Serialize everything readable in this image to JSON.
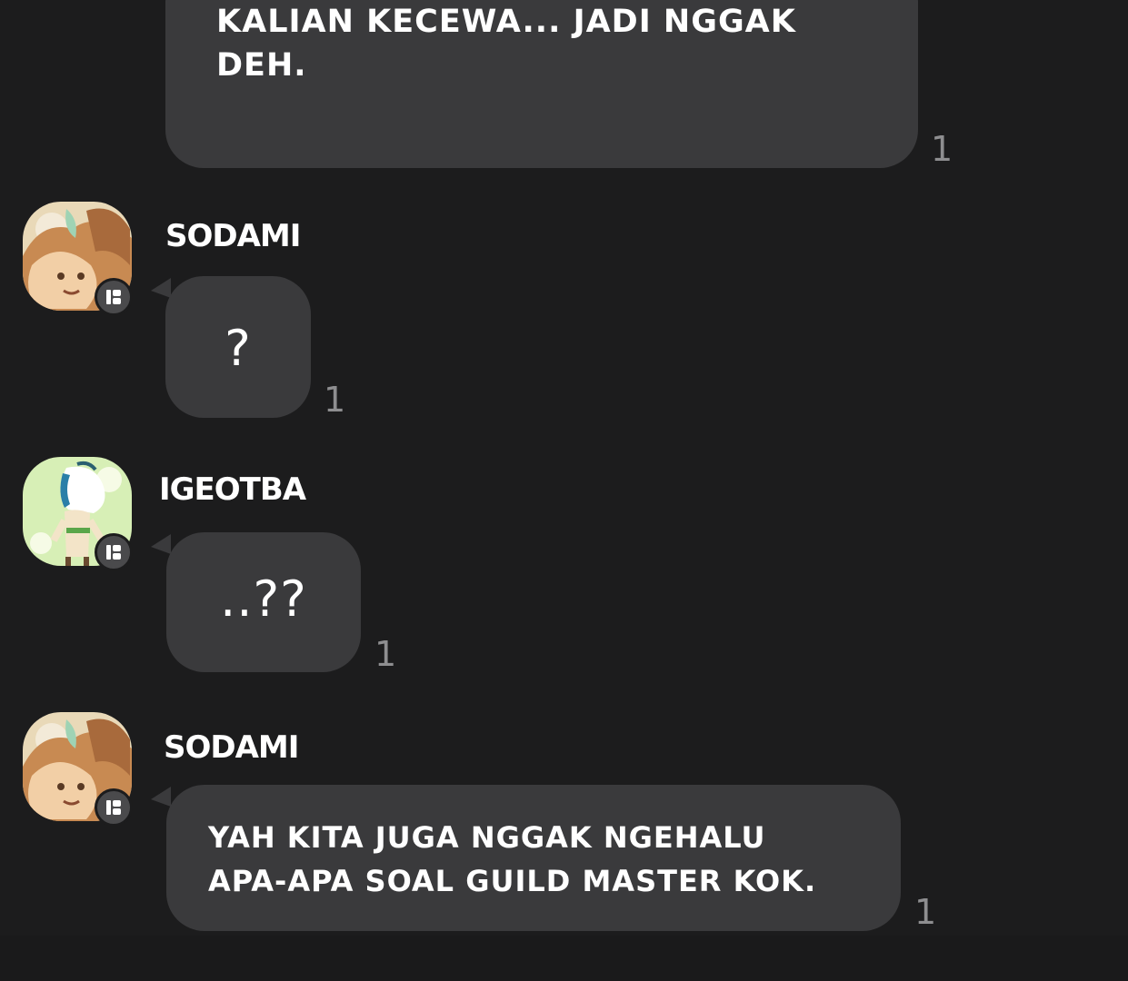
{
  "messages": [
    {
      "sender": "",
      "text": "KALAU AKU DATENG, TAKUTNYA\nKALIAN KECEWA... JADI NGGAK\nDEH.",
      "read_count": "1"
    },
    {
      "sender": "SODAMI",
      "avatar": "sodami-avatar",
      "text": "?",
      "read_count": "1"
    },
    {
      "sender": "IGEOTBA",
      "avatar": "igeotba-avatar",
      "text": "..??",
      "read_count": "1"
    },
    {
      "sender": "SODAMI",
      "avatar": "sodami-avatar",
      "text": "YAH KITA JUGA NGGAK NGEHALU\nAPA-APA SOAL GUILD MASTER KOK.",
      "read_count": "1"
    }
  ],
  "colors": {
    "background": "#1c1c1d",
    "bubble": "#3a3a3c",
    "text": "#ffffff",
    "read_count": "#8e8e90",
    "badge": "#4a4a4c"
  },
  "icons": {
    "badge": "app-badge-icon"
  }
}
